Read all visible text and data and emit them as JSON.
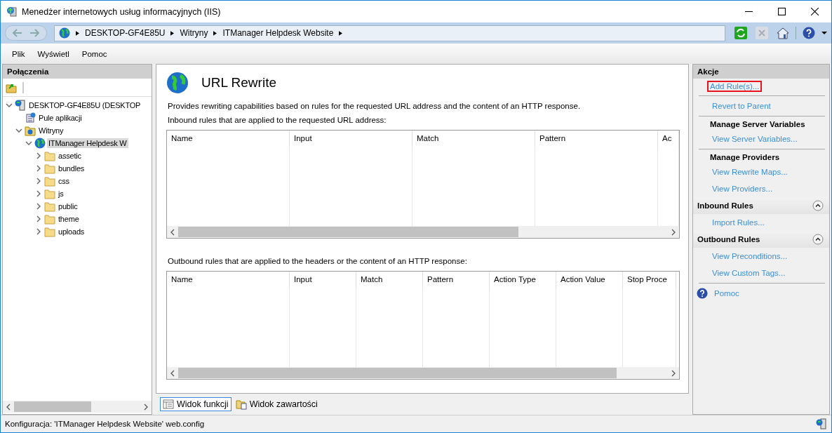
{
  "window": {
    "title": "Menedżer internetowych usług informacyjnych (IIS)"
  },
  "address_bar": {
    "breadcrumb": [
      "DESKTOP-GF4E85U",
      "Witryny",
      "ITManager Helpdesk Website"
    ]
  },
  "menu": [
    "Plik",
    "Wyświetl",
    "Pomoc"
  ],
  "connections": {
    "title": "Połączenia",
    "tree": [
      {
        "label": "DESKTOP-GF4E85U (DESKTOP",
        "kind": "server",
        "expanded": true,
        "selected": false,
        "children": [
          {
            "label": "Pule aplikacji",
            "kind": "pools",
            "selected": false
          },
          {
            "label": "Witryny",
            "kind": "sites",
            "expanded": true,
            "selected": false,
            "children": [
              {
                "label": "ITManager Helpdesk W",
                "kind": "site",
                "expanded": true,
                "selected": true,
                "children": [
                  {
                    "label": "assetic",
                    "kind": "folder",
                    "expanded": false,
                    "selected": false
                  },
                  {
                    "label": "bundles",
                    "kind": "folder",
                    "expanded": false,
                    "selected": false
                  },
                  {
                    "label": "css",
                    "kind": "folder",
                    "expanded": false,
                    "selected": false
                  },
                  {
                    "label": "js",
                    "kind": "folder",
                    "expanded": false,
                    "selected": false
                  },
                  {
                    "label": "public",
                    "kind": "folder",
                    "expanded": false,
                    "selected": false
                  },
                  {
                    "label": "theme",
                    "kind": "folder",
                    "expanded": false,
                    "selected": false
                  },
                  {
                    "label": "uploads",
                    "kind": "folder",
                    "expanded": false,
                    "selected": false
                  }
                ]
              }
            ]
          }
        ]
      }
    ]
  },
  "feature": {
    "title": "URL Rewrite",
    "description": "Provides rewriting capabilities based on rules for the requested URL address and the content of an HTTP response.",
    "tables": [
      {
        "label": "Inbound rules that are applied to the requested URL address:",
        "columns": [
          "Name",
          "Input",
          "Match",
          "Pattern",
          "Ac"
        ]
      },
      {
        "label": "Outbound rules that are applied to the headers or the content of an HTTP response:",
        "columns": [
          "Name",
          "Input",
          "Match",
          "Pattern",
          "Action Type",
          "Action Value",
          "Stop Proce"
        ]
      }
    ]
  },
  "view_tabs": [
    {
      "label": "Widok funkcji",
      "selected": true
    },
    {
      "label": "Widok zawartości",
      "selected": false
    }
  ],
  "actions": {
    "title": "Akcje",
    "items": [
      {
        "kind": "link",
        "label": "Add Rule(s)...",
        "highlighted": true
      },
      {
        "kind": "separator"
      },
      {
        "kind": "link",
        "label": "Revert to Parent",
        "highlighted": false
      },
      {
        "kind": "separator"
      },
      {
        "kind": "heading",
        "label": "Manage Server Variables"
      },
      {
        "kind": "link",
        "label": "View Server Variables...",
        "highlighted": false
      },
      {
        "kind": "separator"
      },
      {
        "kind": "heading",
        "label": "Manage Providers"
      },
      {
        "kind": "link",
        "label": "View Rewrite Maps...",
        "highlighted": false
      },
      {
        "kind": "link",
        "label": "View Providers...",
        "highlighted": false
      },
      {
        "kind": "group",
        "label": "Inbound Rules",
        "expanded": true
      },
      {
        "kind": "link",
        "label": "Import Rules...",
        "highlighted": false
      },
      {
        "kind": "group",
        "label": "Outbound Rules",
        "expanded": true
      },
      {
        "kind": "link",
        "label": "View Preconditions...",
        "highlighted": false
      },
      {
        "kind": "link",
        "label": "View Custom Tags...",
        "highlighted": false
      },
      {
        "kind": "separator"
      },
      {
        "kind": "help",
        "label": "Pomoc"
      }
    ]
  },
  "status_bar": {
    "text": "Konfiguracja: 'ITManager Helpdesk Website' web.config"
  }
}
